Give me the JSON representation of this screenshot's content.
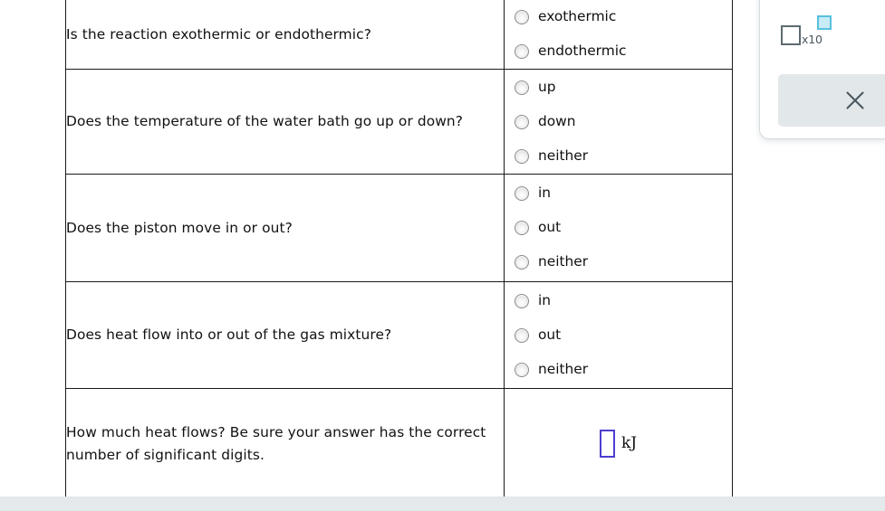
{
  "table": {
    "rows": [
      {
        "question": "Is the reaction exothermic or endothermic?",
        "answer_type": "radio",
        "options": [
          "exothermic",
          "endothermic"
        ]
      },
      {
        "question": "Does the temperature of the water bath go up or down?",
        "answer_type": "radio",
        "options": [
          "up",
          "down",
          "neither"
        ]
      },
      {
        "question": "Does the piston move in or out?",
        "answer_type": "radio",
        "options": [
          "in",
          "out",
          "neither"
        ]
      },
      {
        "question": "Does heat flow into or out of the gas mixture?",
        "answer_type": "radio",
        "options": [
          "in",
          "out",
          "neither"
        ]
      },
      {
        "question": "How much heat flows? Be sure your answer has the correct number of significant digits.",
        "answer_type": "input",
        "value": "",
        "unit": "kJ"
      }
    ]
  },
  "tool_panel": {
    "sci_notation": {
      "label": "x10",
      "icon": "scientific-notation-icon",
      "big_square_color": "#5c6a72",
      "small_square_border": "#58c0de",
      "small_square_fill": "#c8ebf5"
    },
    "clear": {
      "icon": "close-x-icon",
      "background": "#e2e8ea",
      "glyph_color": "#4b585f"
    }
  },
  "colors": {
    "table_border": "#1a1a1a",
    "text": "#111111",
    "input_border": "#4b3fd0",
    "radio_border": "#8c8c8c",
    "footer_bar": "#e4e9ec",
    "panel_border": "#d4dade"
  }
}
